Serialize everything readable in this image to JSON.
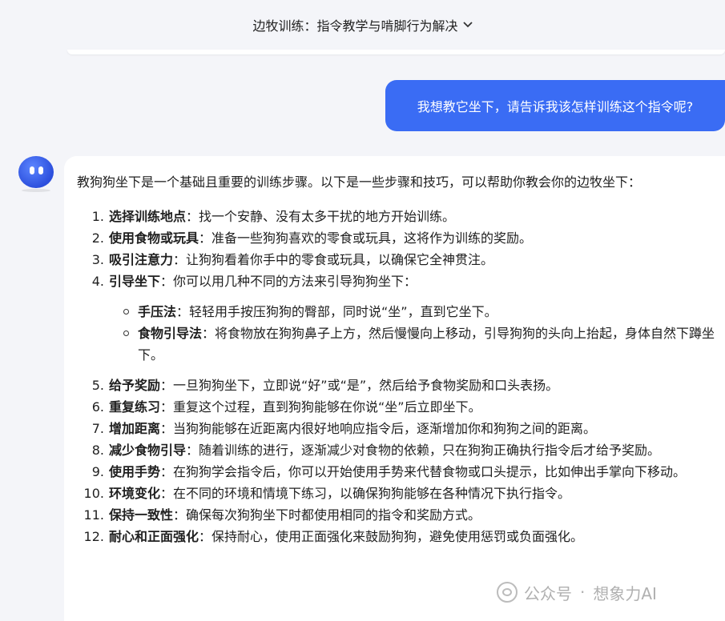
{
  "header": {
    "title": "边牧训练：指令教学与啃脚行为解决",
    "chevron_icon": "chevron-down-icon"
  },
  "user_message": "我想教它坐下，请告诉我该怎样训练这个指令呢?",
  "assistant": {
    "avatar_icon": "robot-avatar-icon",
    "intro": "教狗狗坐下是一个基础且重要的训练步骤。以下是一些步骤和技巧，可以帮助你教会你的边牧坐下：",
    "steps": [
      {
        "num": "1.",
        "title": "选择训练地点",
        "text": "：找一个安静、没有太多干扰的地方开始训练。"
      },
      {
        "num": "2.",
        "title": "使用食物或玩具",
        "text": "：准备一些狗狗喜欢的零食或玩具，这将作为训练的奖励。"
      },
      {
        "num": "3.",
        "title": "吸引注意力",
        "text": "：让狗狗看着你手中的零食或玩具，以确保它全神贯注。"
      },
      {
        "num": "4.",
        "title": "引导坐下",
        "text": "：你可以用几种不同的方法来引导狗狗坐下：",
        "sub": [
          {
            "title": "手压法",
            "text": "：轻轻用手按压狗狗的臀部，同时说“坐”，直到它坐下。"
          },
          {
            "title": "食物引导法",
            "text": "：将食物放在狗狗鼻子上方，然后慢慢向上移动，引导狗狗的头向上抬起，身体自然下蹲坐下。"
          }
        ]
      },
      {
        "num": "5.",
        "title": "给予奖励",
        "text": "：一旦狗狗坐下，立即说“好”或“是”，然后给予食物奖励和口头表扬。"
      },
      {
        "num": "6.",
        "title": "重复练习",
        "text": "：重复这个过程，直到狗狗能够在你说“坐”后立即坐下。"
      },
      {
        "num": "7.",
        "title": "增加距离",
        "text": "：当狗狗能够在近距离内很好地响应指令后，逐渐增加你和狗狗之间的距离。"
      },
      {
        "num": "8.",
        "title": "减少食物引导",
        "text": "：随着训练的进行，逐渐减少对食物的依赖，只在狗狗正确执行指令后才给予奖励。"
      },
      {
        "num": "9.",
        "title": "使用手势",
        "text": "：在狗狗学会指令后，你可以开始使用手势来代替食物或口头提示，比如伸出手掌向下移动。"
      },
      {
        "num": "10.",
        "title": "环境变化",
        "text": "：在不同的环境和情境下练习，以确保狗狗能够在各种情况下执行指令。"
      },
      {
        "num": "11.",
        "title": "保持一致性",
        "text": "：确保每次狗狗坐下时都使用相同的指令和奖励方式。"
      },
      {
        "num": "12.",
        "title": "耐心和正面强化",
        "text": "：保持耐心，使用正面强化来鼓励狗狗，避免使用惩罚或负面强化。"
      }
    ]
  },
  "watermark": {
    "icon": "wechat-official-account-icon",
    "left": "公众号",
    "right": "想象力AI"
  }
}
